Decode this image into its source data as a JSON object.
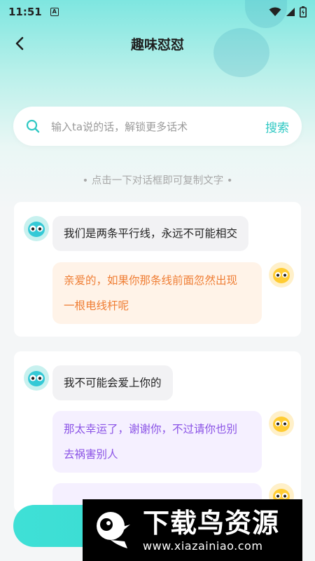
{
  "status_bar": {
    "time": "11:51",
    "notif_letter": "A"
  },
  "header": {
    "title": "趣味怼怼"
  },
  "search": {
    "placeholder": "输入ta说的话，解锁更多话术",
    "button_label": "搜索"
  },
  "hint": "• 点击一下对话框即可复制文字 •",
  "conversations": [
    {
      "prompt": "我们是两条平行线，永远不可能相交",
      "reply_line1": "亲爱的，如果你那条线前面忽然出现",
      "reply_line2": "一根电线杆呢"
    },
    {
      "prompt": "我不可能会爱上你的",
      "reply_line1": "那太幸运了，谢谢你，不过请你也别",
      "reply_line2": "去祸害别人"
    }
  ],
  "watermark": {
    "title": "下载鸟资源",
    "url": "www.xiazainiao.com"
  },
  "colors": {
    "accent": "#2ec8c3",
    "reply_orange": "#ef7d33",
    "reply_purple": "#8a52e6"
  }
}
